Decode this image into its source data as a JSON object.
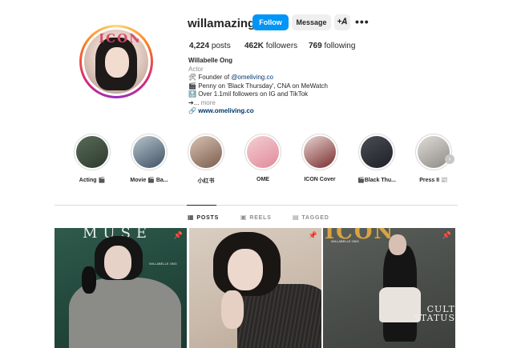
{
  "profile": {
    "username": "willamazing",
    "verified": true,
    "avatar_logo": "ICON",
    "follow_label": "Follow",
    "message_label": "Message",
    "add_user_icon": "add-user-icon",
    "more_label": "•••"
  },
  "stats": {
    "posts_count": "4,224",
    "posts_label": "posts",
    "followers_count": "462K",
    "followers_label": "followers",
    "following_count": "769",
    "following_label": "following"
  },
  "bio": {
    "name": "Willabelle Ong",
    "category": "Actor",
    "line1_emoji": "🛠",
    "line1_text": "Founder of ",
    "line1_mention": "@omeliving.co",
    "line2_emoji": "🎬",
    "line2_text": "Penny on 'Black Thursday', CNA on MeWatch",
    "line3_emoji": "🔝",
    "line3_text": "Over 1.1mil followers on IG and TikTok",
    "line4_text": "➔...",
    "more_label": "more",
    "link_icon": "link-icon",
    "link_text": "www.omeliving.co"
  },
  "highlights": [
    {
      "label": "Acting 🎬",
      "color_a": "#5a6b58",
      "color_b": "#2c3a2d"
    },
    {
      "label": "Movie 🎬 Ba...",
      "color_a": "#b8c4cc",
      "color_b": "#3d5064"
    },
    {
      "label": "小红书",
      "color_a": "#d8c2b2",
      "color_b": "#7a5c4c"
    },
    {
      "label": "OME",
      "color_a": "#f4cfd4",
      "color_b": "#e08a98"
    },
    {
      "label": "ICON Cover",
      "color_a": "#e6d4cf",
      "color_b": "#7a2c2f"
    },
    {
      "label": "🎬Black Thu...",
      "color_a": "#4a4d55",
      "color_b": "#1d2026"
    },
    {
      "label": "Press II 📰",
      "color_a": "#e0ddd8",
      "color_b": "#8d8a86"
    }
  ],
  "tabs": [
    {
      "label": "POSTS",
      "icon": "grid-icon",
      "active": true
    },
    {
      "label": "REELS",
      "icon": "reels-icon",
      "active": false
    },
    {
      "label": "TAGGED",
      "icon": "tagged-icon",
      "active": false
    }
  ],
  "posts": [
    {
      "cover_title": "MUSE",
      "caption": "WILLABELLE ONG",
      "pinned": true
    },
    {
      "pinned": true
    },
    {
      "cover_title": "ICON",
      "caption": "WILLABELLE ONG",
      "cover_text": "CULT STATUS",
      "pinned": true
    }
  ],
  "colors": {
    "accent": "#0095f6",
    "verified": "#3897f0",
    "link": "#00376b",
    "muted": "#8e8e8e"
  }
}
